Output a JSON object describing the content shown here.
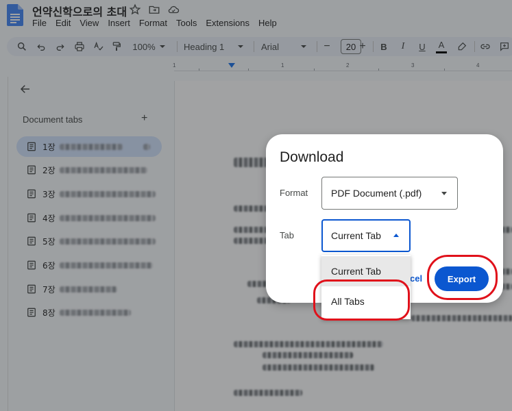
{
  "header": {
    "doc_title": "언약신학으로의 초대",
    "menu": [
      "File",
      "Edit",
      "View",
      "Insert",
      "Format",
      "Tools",
      "Extensions",
      "Help"
    ]
  },
  "toolbar": {
    "zoom": "100%",
    "style": "Heading 1",
    "font": "Arial",
    "font_size": "20",
    "minus": "−",
    "plus": "+",
    "bold": "B",
    "italic": "I",
    "underline": "U",
    "text_color": "A"
  },
  "ruler": {
    "numbers": [
      "1",
      "1",
      "2",
      "3",
      "4",
      "5"
    ]
  },
  "sidebar": {
    "heading": "Document tabs",
    "add": "+",
    "tabs": [
      {
        "label": "1장",
        "active": true
      },
      {
        "label": "2장"
      },
      {
        "label": "3장"
      },
      {
        "label": "4장"
      },
      {
        "label": "5장"
      },
      {
        "label": "6장"
      },
      {
        "label": "7장"
      },
      {
        "label": "8장"
      }
    ]
  },
  "dialog": {
    "title": "Download",
    "format_label": "Format",
    "format_value": "PDF Document (.pdf)",
    "tab_label": "Tab",
    "tab_value": "Current Tab",
    "cancel_text": "cel",
    "export_label": "Export"
  },
  "dropdown": {
    "options": [
      "Current Tab",
      "All Tabs"
    ]
  },
  "colors": {
    "accent": "#0b57d0",
    "annotation": "#e0101a",
    "active_tab": "#d3e3fd"
  }
}
